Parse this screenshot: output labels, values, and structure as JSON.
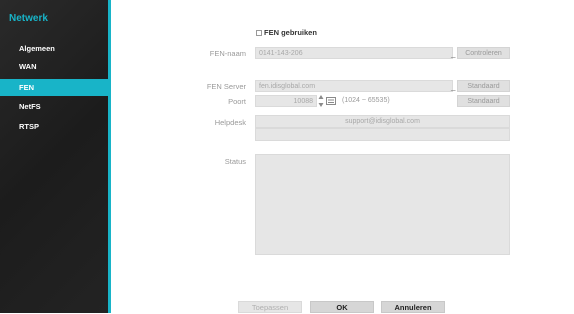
{
  "sidebar": {
    "title": "Netwerk",
    "items": [
      {
        "label": "Algemeen"
      },
      {
        "label": "WAN"
      },
      {
        "label": "FEN"
      },
      {
        "label": "NetFS"
      },
      {
        "label": "RTSP"
      }
    ],
    "active_item": "FEN"
  },
  "fen": {
    "enable_label": "FEN gebruiken",
    "enable_checked": false,
    "name_label": "FEN-naam",
    "name_value": "0141-143-206",
    "check_button": "Controleren",
    "server_label": "FEN Server",
    "server_value": "fen.idisglobal.com",
    "server_default_button": "Standaard",
    "port_label": "Poort",
    "port_value": "10088",
    "port_range": "(1024 ~ 65535)",
    "port_default_button": "Standaard",
    "helpdesk_label": "Helpdesk",
    "helpdesk_value": "support@idisglobal.com",
    "helpdesk_extra": "",
    "status_label": "Status",
    "status_value": ""
  },
  "footer": {
    "apply": "Toepassen",
    "ok": "OK",
    "cancel": "Annuleren"
  },
  "colors": {
    "accent": "#18b4c8",
    "sidebar_bg": "#222222"
  }
}
